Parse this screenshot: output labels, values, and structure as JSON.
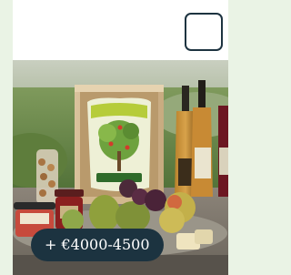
{
  "card": {
    "price_label": "+ €4000-4500",
    "select_icon": "checkbox-outline-icon",
    "image_subject": "gift-hamper-photo",
    "colors": {
      "page_background": "#eaf3e5",
      "pill_background": "#1c3340",
      "pill_text": "#ffffff",
      "checkbox_border": "#1d3340"
    }
  }
}
